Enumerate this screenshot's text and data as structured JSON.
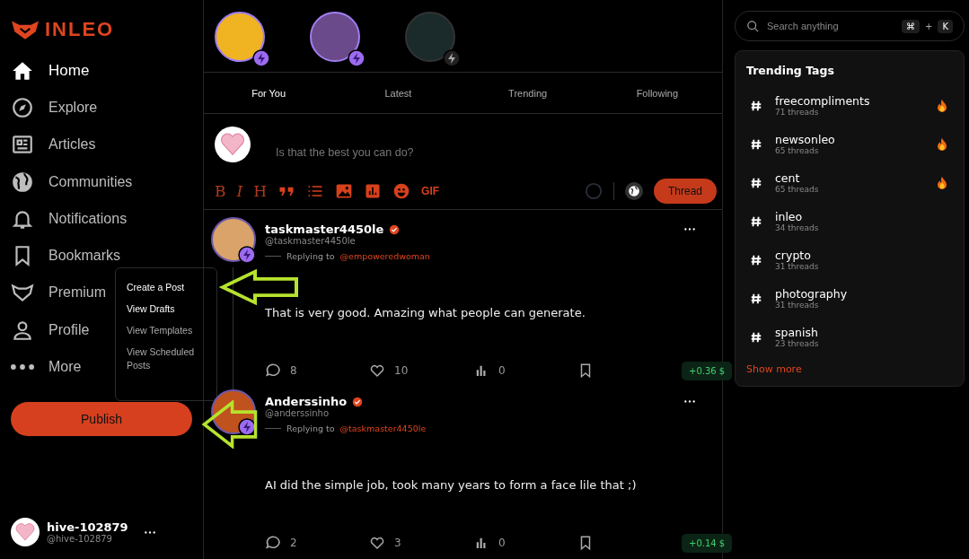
{
  "brand": {
    "name": "INLEO"
  },
  "nav": [
    {
      "label": "Home",
      "selected": true
    },
    {
      "label": "Explore",
      "selected": false
    },
    {
      "label": "Articles",
      "selected": false
    },
    {
      "label": "Communities",
      "selected": false
    },
    {
      "label": "Notifications",
      "selected": false
    },
    {
      "label": "Bookmarks",
      "selected": false
    },
    {
      "label": "Premium",
      "selected": false
    },
    {
      "label": "Profile",
      "selected": false
    },
    {
      "label": "More",
      "selected": false
    }
  ],
  "publish_menu": [
    {
      "label": "Create a Post",
      "highlighted": true
    },
    {
      "label": "View Drafts",
      "highlighted": true
    },
    {
      "label": "View Templates",
      "highlighted": false
    },
    {
      "label": "View Scheduled Posts",
      "highlighted": false
    }
  ],
  "publish_button": "Publish",
  "account": {
    "name": "hive-102879",
    "handle": "@hive-102879"
  },
  "stories": [
    {
      "premium": true
    },
    {
      "premium": true
    },
    {
      "premium": false
    }
  ],
  "tabs": [
    {
      "label": "For You",
      "selected": true
    },
    {
      "label": "Latest",
      "selected": false
    },
    {
      "label": "Trending",
      "selected": false
    },
    {
      "label": "Following",
      "selected": false
    }
  ],
  "composer": {
    "placeholder": "Is that the best you can do?",
    "toolbar": [
      {
        "kind": "letter",
        "label": "B"
      },
      {
        "kind": "italic",
        "label": "I"
      },
      {
        "kind": "letter",
        "label": "H"
      },
      {
        "kind": "quote"
      },
      {
        "kind": "list"
      },
      {
        "kind": "image"
      },
      {
        "kind": "chart"
      },
      {
        "kind": "emoji"
      },
      {
        "kind": "letter",
        "label": "GIF"
      }
    ],
    "submit": "Thread"
  },
  "posts": [
    {
      "author": "taskmaster4450le",
      "verified": true,
      "handle": "@taskmaster4450le",
      "reply_label": "Replying to",
      "reply_to": "@empoweredwoman",
      "text": "That is very good. Amazing what people can generate.",
      "comments": "8",
      "likes": "10",
      "views": "0",
      "payout": "+0.36 $"
    },
    {
      "author": "Anderssinho",
      "verified": true,
      "handle": "@anderssinho",
      "reply_label": "Replying to",
      "reply_to": "@taskmaster4450le",
      "text": "AI did the simple job, took many years to form a face lile that ;)",
      "comments": "2",
      "likes": "3",
      "views": "0",
      "payout": "+0.14 $"
    }
  ],
  "search": {
    "placeholder": "Search anything",
    "keys": [
      "⌘",
      "K"
    ],
    "key_joiner": "+"
  },
  "trending": {
    "title": "Trending Tags",
    "tags": [
      {
        "name": "freecompliments",
        "count": "71 threads",
        "hot": true
      },
      {
        "name": "newsonleo",
        "count": "65 threads",
        "hot": true
      },
      {
        "name": "cent",
        "count": "65 threads",
        "hot": true
      },
      {
        "name": "inleo",
        "count": "34 threads",
        "hot": false
      },
      {
        "name": "crypto",
        "count": "31 threads",
        "hot": false
      },
      {
        "name": "photography",
        "count": "31 threads",
        "hot": false
      },
      {
        "name": "spanish",
        "count": "23 threads",
        "hot": false
      }
    ],
    "more": "Show more"
  }
}
